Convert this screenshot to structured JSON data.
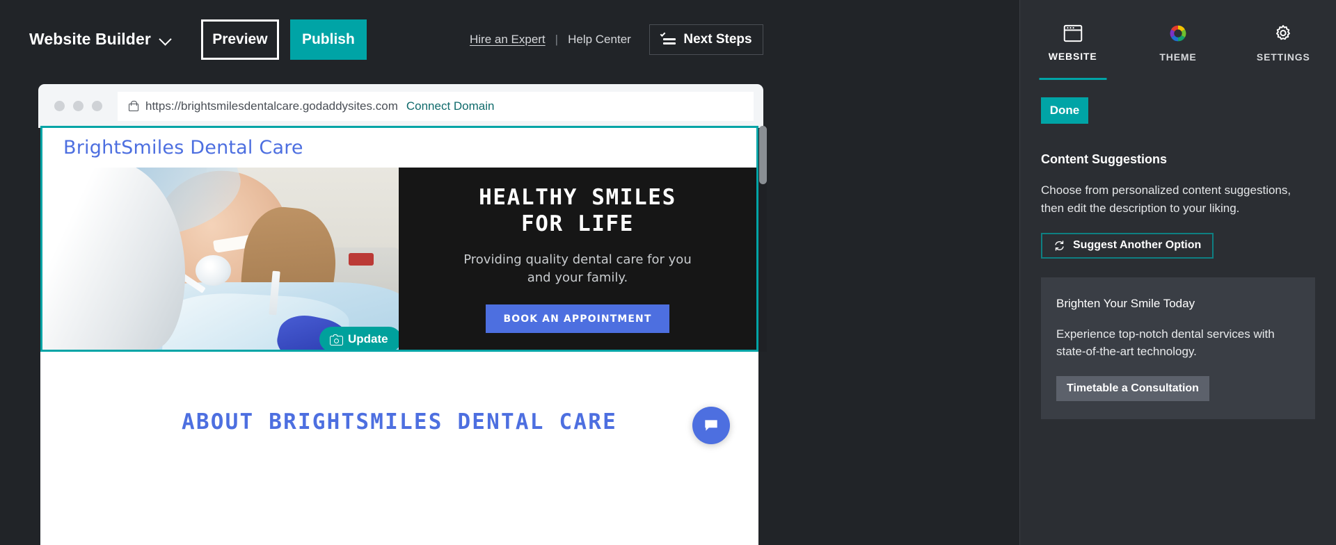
{
  "header": {
    "app_name": "Website Builder",
    "chevron_icon": "chevron-down-icon",
    "preview_label": "Preview",
    "publish_label": "Publish",
    "hire_expert_label": "Hire an Expert",
    "separator": "|",
    "help_center_label": "Help Center",
    "next_steps_label": "Next Steps",
    "next_steps_icon": "checklist-icon",
    "publish_color": "#00a4a6"
  },
  "browser": {
    "lock_icon": "lock-icon",
    "url": "https://brightsmilesdentalcare.godaddysites.com",
    "connect_domain_label": "Connect Domain",
    "connect_domain_color": "#0f6a6b"
  },
  "site": {
    "logo_text": "BrightSmiles Dental Care",
    "logo_color": "#4d6fe0",
    "selection_color": "#00a4a6",
    "hero": {
      "headline_line1": "HEALTHY SMILES",
      "headline_line2": "FOR LIFE",
      "subtext_line1": "Providing quality dental care for you",
      "subtext_line2": "and your family.",
      "cta_label": "BOOK AN APPOINTMENT",
      "cta_color": "#4d6fe0",
      "update_label": "Update",
      "update_icon": "camera-icon",
      "image_alt": "dental patient smiling in chair"
    },
    "about_heading": "ABOUT BRIGHTSMILES DENTAL CARE",
    "chat_icon": "chat-bubble-icon"
  },
  "panel": {
    "tabs": [
      {
        "label": "WEBSITE",
        "icon": "browser-window-icon",
        "active": true
      },
      {
        "label": "THEME",
        "icon": "color-wheel-icon",
        "active": false
      },
      {
        "label": "SETTINGS",
        "icon": "gear-icon",
        "active": false
      }
    ],
    "done_label": "Done",
    "section_title": "Content Suggestions",
    "description_line1": "Choose from personalized content suggestions,",
    "description_line2": "then edit the description to your liking.",
    "suggest_button_label": "Suggest Another Option",
    "suggest_button_icon": "refresh-icon",
    "suggestion": {
      "heading": "Brighten Your Smile Today",
      "body_line1": "Experience top-notch dental services with",
      "body_line2": "state-of-the-art technology.",
      "button_label": "Timetable a Consultation"
    },
    "accent_color": "#00a4a6"
  }
}
